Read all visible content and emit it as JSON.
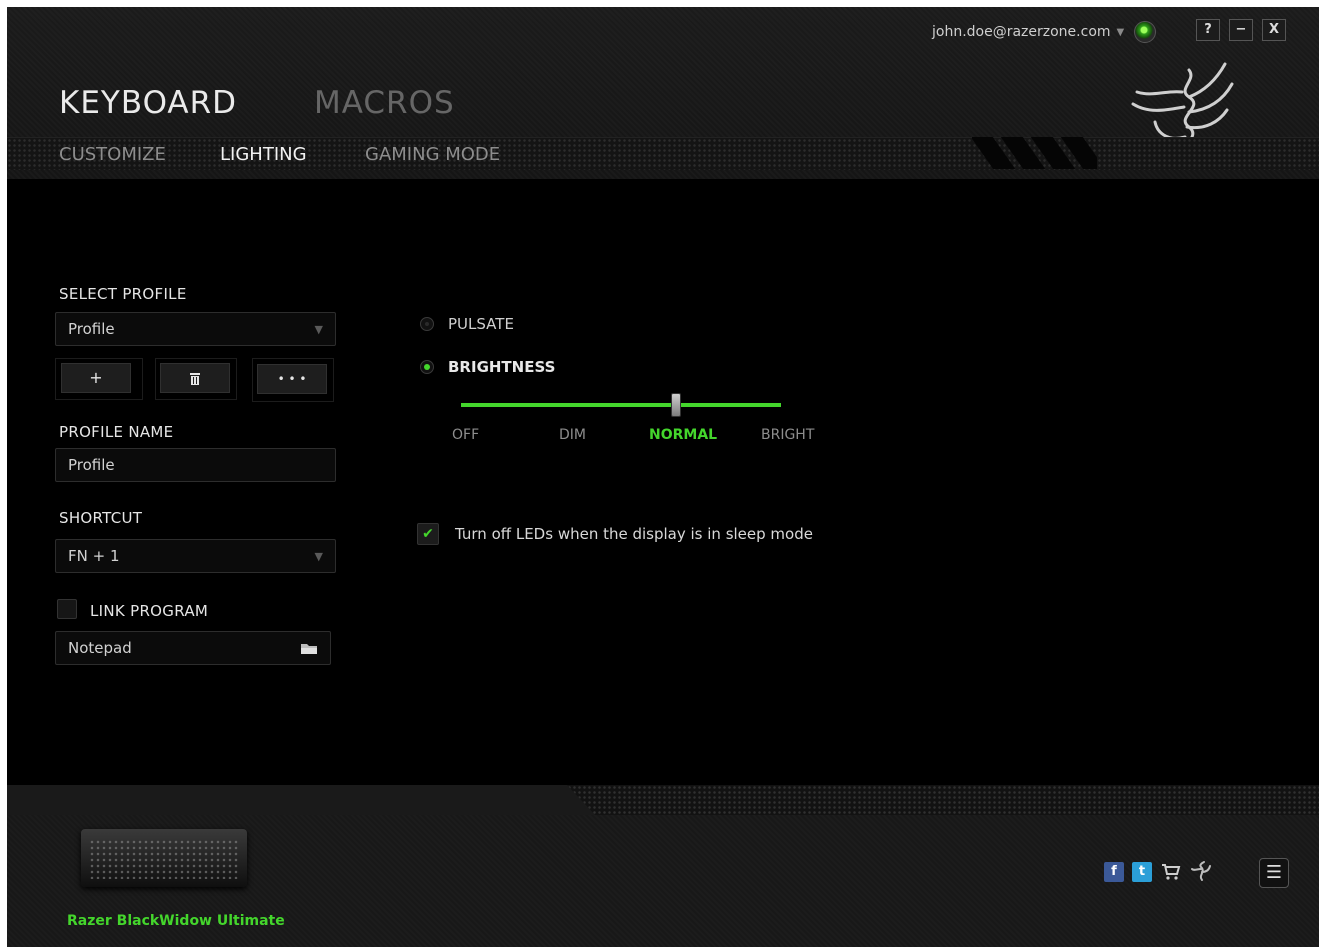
{
  "account": {
    "email": "john.doe@razerzone.com",
    "arrow": "▼"
  },
  "window_controls": {
    "help": "?",
    "minimize": "−",
    "close": "X"
  },
  "nav": {
    "main_tabs": [
      "KEYBOARD",
      "MACROS"
    ],
    "sub_tabs": [
      "CUSTOMIZE",
      "LIGHTING",
      "GAMING MODE"
    ],
    "active_main": "KEYBOARD",
    "active_sub": "LIGHTING"
  },
  "profile": {
    "select_label": "SELECT PROFILE",
    "selected": "Profile",
    "add_label": "+",
    "delete_icon": "trash-icon",
    "more_label": "• • •",
    "name_label": "PROFILE NAME",
    "name_value": "Profile",
    "shortcut_label": "SHORTCUT",
    "shortcut_value": "FN + 1",
    "link_label": "LINK PROGRAM",
    "link_checked": false,
    "program_value": "Notepad"
  },
  "lighting": {
    "pulsate_label": "PULSATE",
    "pulsate_selected": false,
    "brightness_label": "BRIGHTNESS",
    "brightness_selected": true,
    "levels": [
      "OFF",
      "DIM",
      "NORMAL",
      "BRIGHT"
    ],
    "current_level": "NORMAL",
    "sleep_label": "Turn off LEDs when the display is in sleep mode",
    "sleep_checked": true
  },
  "footer": {
    "device_name": "Razer BlackWidow Ultimate",
    "social_icons": [
      "facebook-icon",
      "twitter-icon",
      "cart-icon",
      "razer-icon"
    ],
    "menu_icon": "☰"
  },
  "colors": {
    "accent": "#44d62c",
    "background": "#000000"
  }
}
